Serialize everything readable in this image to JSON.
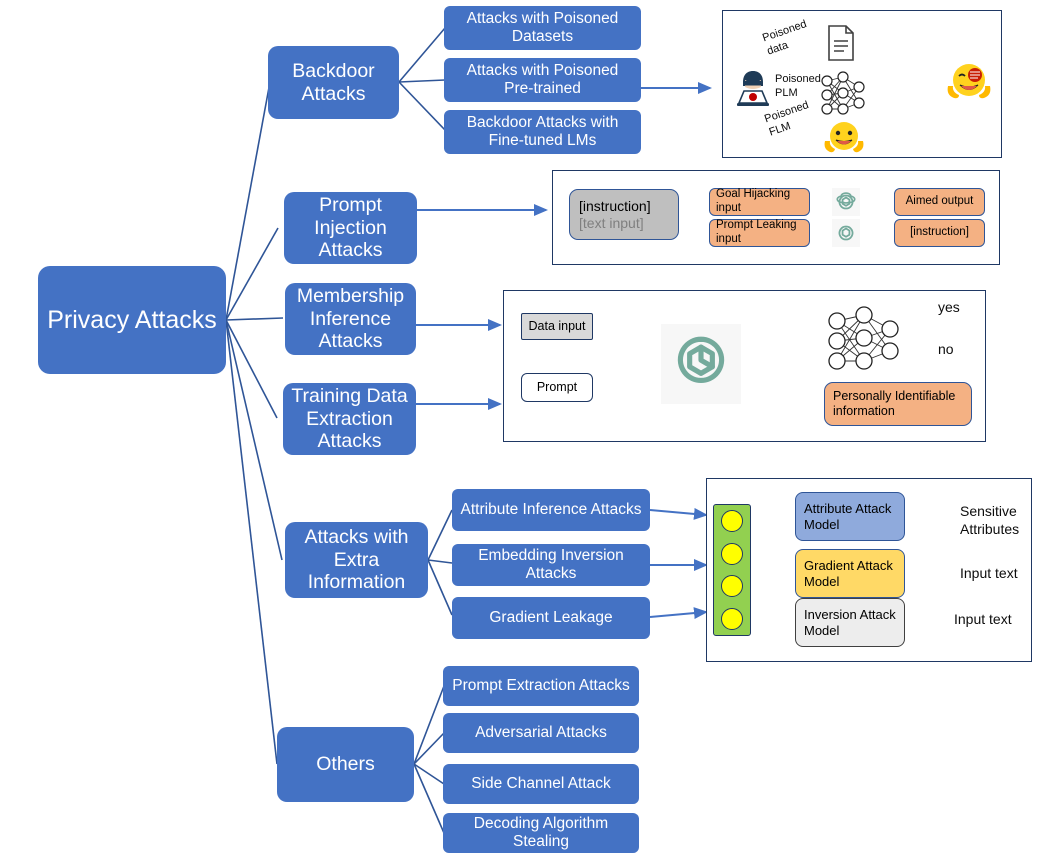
{
  "title": "Privacy Attacks taxonomy diagram",
  "root": {
    "label": "Privacy Attacks"
  },
  "branches": [
    {
      "id": "backdoor",
      "label": "Backdoor Attacks",
      "children": [
        "Attacks with Poisoned Datasets",
        "Attacks with Poisoned Pre-trained",
        "Backdoor Attacks with Fine-tuned LMs"
      ]
    },
    {
      "id": "prompt_injection",
      "label": "Prompt Injection Attacks",
      "children": []
    },
    {
      "id": "membership",
      "label": "Membership Inference Attacks",
      "children": []
    },
    {
      "id": "training_extraction",
      "label": "Training Data Extraction Attacks",
      "children": []
    },
    {
      "id": "extra_info",
      "label": "Attacks with Extra Information",
      "children": [
        "Attribute Inference Attacks",
        "Embedding Inversion Attacks",
        "Gradient Leakage"
      ]
    },
    {
      "id": "others",
      "label": "Others",
      "children": [
        "Prompt Extraction Attacks",
        "Adversarial Attacks",
        "Side Channel Attack",
        "Decoding Algorithm Stealing"
      ]
    }
  ],
  "panels": {
    "backdoor": {
      "edge_labels": [
        "Poisoned\ndata",
        "Poisoned\nPLM",
        "Poisoned\nFLM"
      ],
      "icons": [
        "hacker-icon",
        "document-icon",
        "neural-network-icon",
        "huggingface-icon",
        "huggingface-infected-icon"
      ]
    },
    "prompt_injection": {
      "input_box_lines": [
        "[instruction]",
        "[text input]"
      ],
      "attack_boxes": [
        "Goal Hijacking input",
        "Prompt Leaking input"
      ],
      "outputs": [
        "Aimed output",
        "[instruction]"
      ],
      "model_icon": "openai-logo-icon"
    },
    "membership": {
      "inputs": [
        "Data input",
        "Prompt"
      ],
      "model_icon": "openai-logo-icon",
      "classifier_icon": "neural-network-icon",
      "classifier_outputs": [
        "yes",
        "no"
      ],
      "leak_output": "Personally Identifiable information"
    },
    "extra_info": {
      "gate_icon": "traffic-light-icon",
      "models": [
        "Attribute Attack Model",
        "Gradient Attack Model",
        "Inversion Attack Model"
      ],
      "outputs": [
        "Sensitive Attributes",
        "Input text",
        "Input text"
      ]
    }
  },
  "colors": {
    "node_blue": "#4472C4",
    "panel_border": "#1F3864",
    "edge_blue": "#2F5597",
    "orange": "#F4B183",
    "light_blue": "#8FAADC",
    "yellow": "#FFD966",
    "light_grey": "#EDEDED",
    "green": "#92D050",
    "dot_yellow": "#FFFF00",
    "openai_green": "#74AA9C",
    "red_arrow": "#FF0000",
    "grey_arrow": "#A6A6A6"
  }
}
